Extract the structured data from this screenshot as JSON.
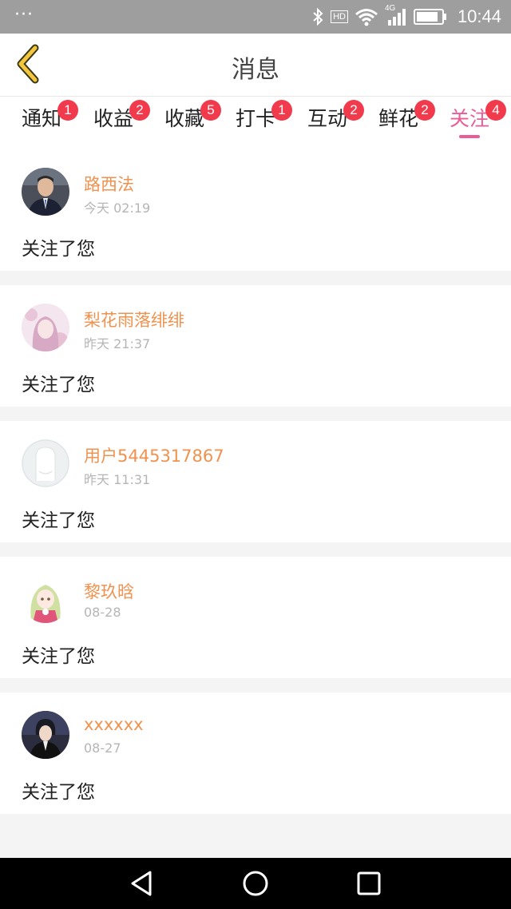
{
  "status_bar": {
    "dots": "···",
    "time": "10:44",
    "hd": "HD",
    "network": "4G"
  },
  "header": {
    "title": "消息"
  },
  "tabs": [
    {
      "label": "通知",
      "badge": "1",
      "active": false
    },
    {
      "label": "收益",
      "badge": "2",
      "active": false
    },
    {
      "label": "收藏",
      "badge": "5",
      "active": false
    },
    {
      "label": "打卡",
      "badge": "1",
      "active": false
    },
    {
      "label": "互动",
      "badge": "2",
      "active": false
    },
    {
      "label": "鲜花",
      "badge": "2",
      "active": false
    },
    {
      "label": "关注",
      "badge": "4",
      "active": true
    }
  ],
  "messages": [
    {
      "name": "路西法",
      "time": "今天 02:19",
      "text": "关注了您",
      "avatar": "avatar-man-suit"
    },
    {
      "name": "梨花雨落绯绯",
      "time": "昨天 21:37",
      "text": "关注了您",
      "avatar": "avatar-anime-girl-pink"
    },
    {
      "name": "用户5445317867",
      "time": "昨天 11:31",
      "text": "关注了您",
      "avatar": "avatar-default"
    },
    {
      "name": "黎玖晗",
      "time": "08-28",
      "text": "关注了您",
      "avatar": "avatar-anime-girl-green"
    },
    {
      "name": "xxxxxx",
      "time": "08-27",
      "text": "关注了您",
      "avatar": "avatar-anime-boy"
    }
  ],
  "colors": {
    "accent": "#e85d97",
    "name": "#f0924f",
    "badge": "#f23a4d",
    "back_arrow": "#f3c63d"
  }
}
